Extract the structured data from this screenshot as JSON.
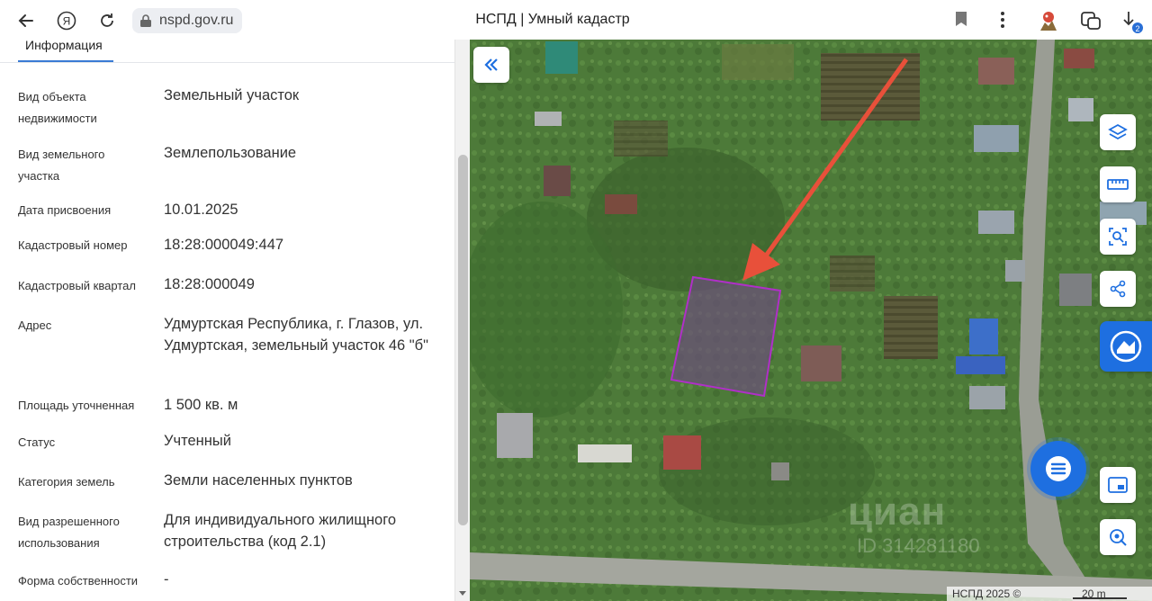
{
  "browser": {
    "url": "nspd.gov.ru",
    "title": "НСПД | Умный кадастр",
    "download_badge": "2"
  },
  "panel": {
    "tab_label": "Информация",
    "rows": [
      {
        "label": "Вид объекта недвижимости",
        "value": "Земельный участок"
      },
      {
        "label": "Вид земельного участка",
        "value": "Землепользование"
      },
      {
        "label": "Дата присвоения",
        "value": "10.01.2025"
      },
      {
        "label": "Кадастровый номер",
        "value": "18:28:000049:447"
      },
      {
        "label": "Кадастровый квартал",
        "value": "18:28:000049"
      },
      {
        "label": "Адрес",
        "value": "Удмуртская Республика, г. Глазов, ул. Удмуртская, земельный участок 46 \"б\""
      },
      {
        "label": "Площадь уточненная",
        "value": "1 500 кв. м"
      },
      {
        "label": "Статус",
        "value": "Учтенный"
      },
      {
        "label": "Категория земель",
        "value": "Земли населенных пунктов"
      },
      {
        "label": "Вид разрешенного использования",
        "value": "Для индивидуального жилищного строительства (код 2.1)"
      },
      {
        "label": "Форма собственности",
        "value": "-"
      }
    ]
  },
  "map": {
    "copyright": "НСПД 2025 ©",
    "scale": "20 m",
    "watermark": "циан",
    "watermark_id": "ID 314281180",
    "parcel_color": "#b02fc8",
    "arrow_color": "#e8503a",
    "accent": "#1e6fe0"
  }
}
